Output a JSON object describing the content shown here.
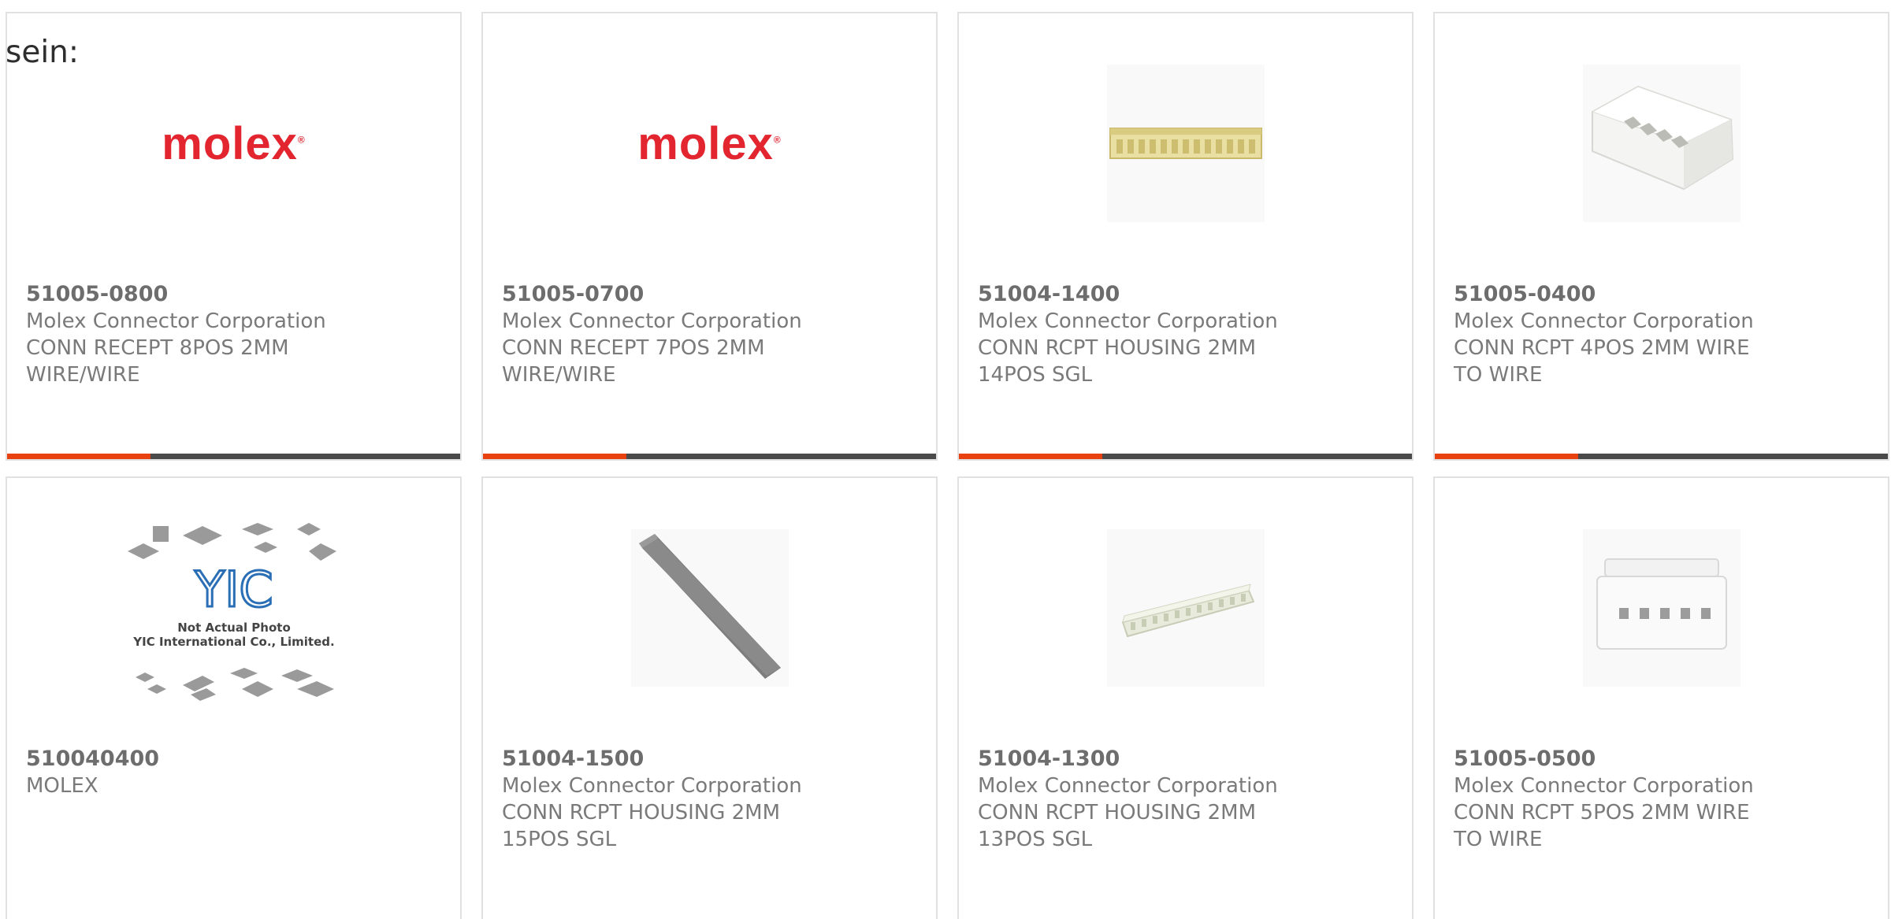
{
  "intro_text": "sein:",
  "products": [
    {
      "part_number": "51005-0800",
      "manufacturer": "Molex Connector Corporation",
      "description": "CONN RECEPT 8POS 2MM WIRE/WIRE",
      "image": "molex-logo",
      "logo_text": "molex"
    },
    {
      "part_number": "51005-0700",
      "manufacturer": "Molex Connector Corporation",
      "description": "CONN RECEPT 7POS 2MM WIRE/WIRE",
      "image": "molex-logo",
      "logo_text": "molex"
    },
    {
      "part_number": "51004-1400",
      "manufacturer": "Molex Connector Corporation",
      "description": "CONN RCPT HOUSING 2MM 14POS SGL",
      "image": "connector-strip-yellow-icon"
    },
    {
      "part_number": "51005-0400",
      "manufacturer": "Molex Connector Corporation",
      "description": "CONN RCPT 4POS 2MM WIRE TO WIRE",
      "image": "connector-housing-4pos-icon"
    },
    {
      "part_number": "510040400",
      "manufacturer": "MOLEX",
      "description": "",
      "image": "placeholder-chips-icon",
      "placeholder_brand": "YIC",
      "placeholder_line1": "Not Actual Photo",
      "placeholder_line2": "YIC International Co., Limited."
    },
    {
      "part_number": "51004-1500",
      "manufacturer": "Molex Connector Corporation",
      "description": "CONN RCPT HOUSING 2MM 15POS SGL",
      "image": "connector-strip-gray-icon"
    },
    {
      "part_number": "51004-1300",
      "manufacturer": "Molex Connector Corporation",
      "description": "CONN RCPT HOUSING 2MM 13POS SGL",
      "image": "connector-strip-white-icon"
    },
    {
      "part_number": "51005-0500",
      "manufacturer": "Molex Connector Corporation",
      "description": "CONN RCPT 5POS 2MM WIRE TO WIRE",
      "image": "connector-housing-5pos-icon"
    }
  ],
  "colors": {
    "accent": "#e8400e",
    "bar": "#4a4a4a",
    "border": "#e1e1e1",
    "molex_red": "#e32530"
  }
}
